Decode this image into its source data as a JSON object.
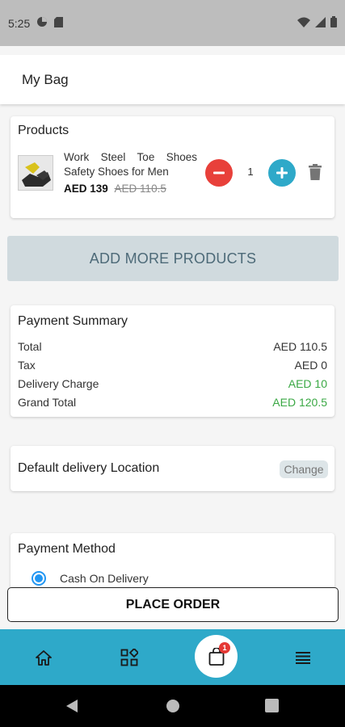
{
  "status_bar": {
    "time": "5:25"
  },
  "app_bar": {
    "title": "My Bag"
  },
  "products": {
    "title": "Products",
    "items": [
      {
        "name": "Work Steel Toe Shoes Safety Shoes for Men",
        "price": "AED 139",
        "old_price": "AED 110.5",
        "quantity": "1"
      }
    ]
  },
  "add_more_label": "ADD MORE PRODUCTS",
  "summary": {
    "title": "Payment Summary",
    "rows": [
      {
        "label": "Total",
        "value": "AED 110.5"
      },
      {
        "label": "Tax",
        "value": "AED 0"
      },
      {
        "label": "Delivery Charge",
        "value": "AED 10"
      },
      {
        "label": "Grand Total",
        "value": "AED 120.5"
      }
    ]
  },
  "delivery": {
    "title": "Default delivery Location",
    "change_label": "Change"
  },
  "payment": {
    "title": "Payment Method",
    "option": "Cash On Delivery"
  },
  "place_order_label": "PLACE ORDER",
  "bottom_nav": {
    "cart_badge": "1"
  },
  "colors": {
    "accent": "#2ea9c9",
    "minus": "#e8403a",
    "green": "#3aa844",
    "radio": "#2196f3"
  }
}
